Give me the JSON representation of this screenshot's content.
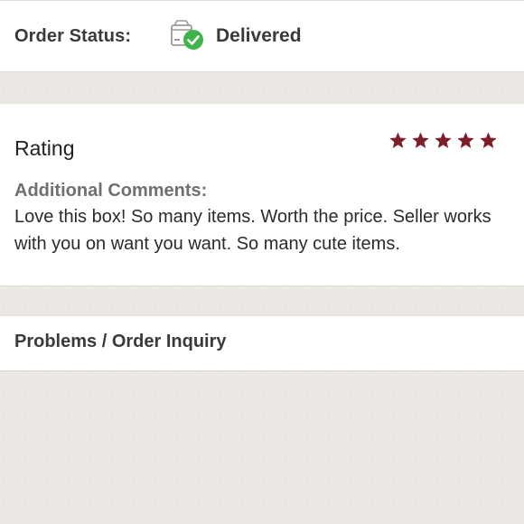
{
  "order_status": {
    "label": "Order Status:",
    "value": "Delivered",
    "icon": "box-delivered-check-icon",
    "check_color": "#3fb44a"
  },
  "rating": {
    "title": "Rating",
    "stars_filled": 5,
    "stars_total": 5,
    "star_color": "#7d1f2b",
    "comments_heading": "Additional Comments:",
    "comments_text": "Love this box! So many items. Worth the price. Seller works with you on want you want. So many cute items."
  },
  "problems": {
    "label": "Problems / Order Inquiry"
  }
}
